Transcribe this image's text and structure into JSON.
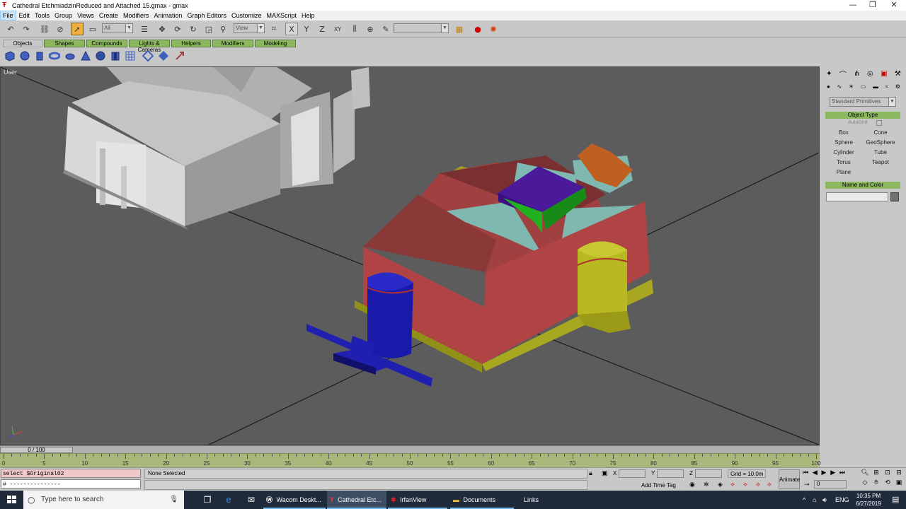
{
  "window": {
    "title": "Cathedral EtchmiadzinReduced and Attached 15.gmax - gmax",
    "minimize": "—",
    "maximize": "❐",
    "close": "✕"
  },
  "menu": [
    "File",
    "Edit",
    "Tools",
    "Group",
    "Views",
    "Create",
    "Modifiers",
    "Animation",
    "Graph Editors",
    "Customize",
    "MAXScript",
    "Help"
  ],
  "toolbar": {
    "selection_filter": "All",
    "reference_coord": "View",
    "named_selection": ""
  },
  "tabs": [
    "Objects",
    "Shapes",
    "Compounds",
    "Lights & Cameras",
    "Helpers",
    "Modifiers",
    "Modeling"
  ],
  "viewport": {
    "label": "User"
  },
  "command_panel": {
    "category": "Standard Primitives",
    "object_type_title": "Object Type",
    "autogrid": "AutoGrid",
    "primitives": [
      "Box",
      "Cone",
      "Sphere",
      "GeoSphere",
      "Cylinder",
      "Tube",
      "Torus",
      "Teapot",
      "Plane"
    ],
    "name_color_title": "Name and Color"
  },
  "timeline": {
    "frame_display": "0 / 100",
    "ticks": [
      "0",
      "5",
      "10",
      "15",
      "20",
      "25",
      "30",
      "35",
      "40",
      "45",
      "50",
      "55",
      "60",
      "65",
      "70",
      "75",
      "80",
      "85",
      "90",
      "95",
      "100"
    ]
  },
  "status": {
    "listener_input": "select $Original02",
    "listener_output": "# ---------------",
    "selection": "None Selected",
    "x_label": "X",
    "y_label": "Y",
    "z_label": "Z",
    "grid": "Grid = 10.0m",
    "add_time_tag": "Add Time Tag",
    "animate": "Animate",
    "current_frame": "0"
  },
  "taskbar": {
    "search_placeholder": "Type here to search",
    "tasks": [
      "Wacom Deskt...",
      "Cathedral Etc...",
      "IrfanView",
      "Documents",
      "Links"
    ],
    "language": "ENG",
    "time": "10:35 PM",
    "date": "6/27/2019"
  },
  "colors": {
    "viewport_bg": "#5c5c5c",
    "ui_bg": "#c8c8c8",
    "tab_green": "#8cb860",
    "taskbar": "#1f2a3b",
    "model_red": "#b04444",
    "model_cyan": "#7fb8b0",
    "model_yellow": "#b8b820",
    "model_blue": "#1a1aaa",
    "model_purple": "#4a1a9a",
    "model_green": "#20b020",
    "model_orange": "#c06020"
  }
}
